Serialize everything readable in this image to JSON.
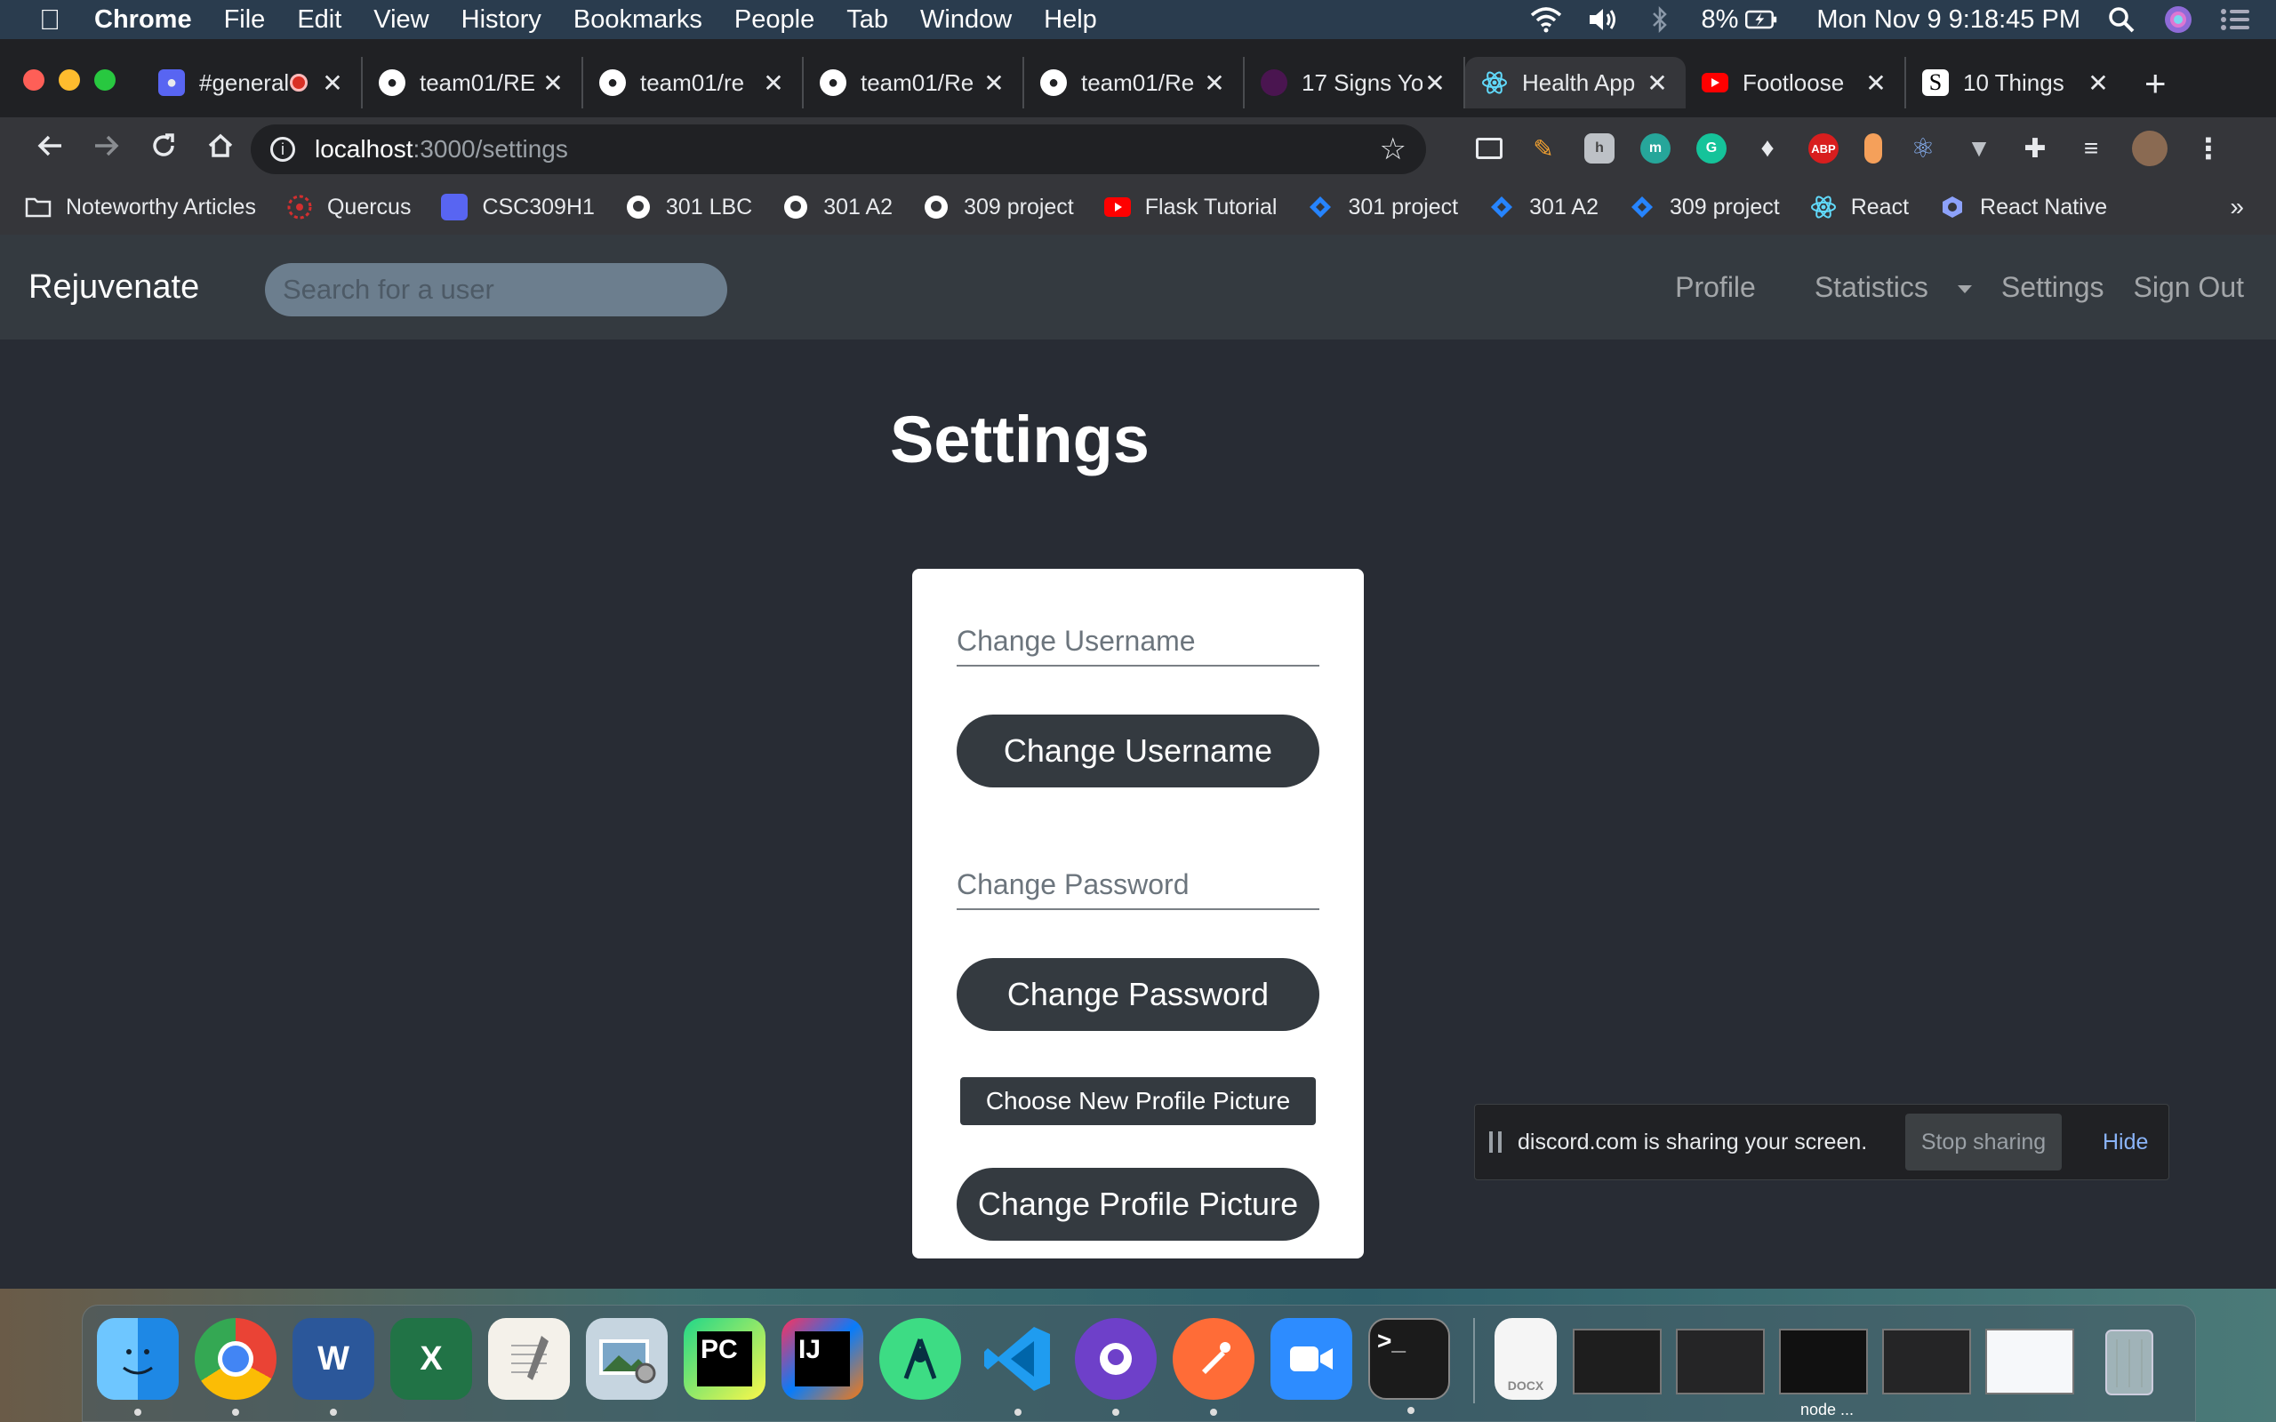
{
  "menubar": {
    "app_name": "Chrome",
    "menus": [
      "File",
      "Edit",
      "View",
      "History",
      "Bookmarks",
      "People",
      "Tab",
      "Window",
      "Help"
    ],
    "battery": "8%",
    "clock": "Mon Nov 9  9:18:45 PM"
  },
  "tabs": [
    {
      "title": "#general",
      "icon": "discord-icon",
      "color": "#5865f2"
    },
    {
      "title": "team01/RE",
      "icon": "github-icon",
      "color": "#ffffff"
    },
    {
      "title": "team01/re",
      "icon": "github-icon",
      "color": "#ffffff"
    },
    {
      "title": "team01/Re",
      "icon": "github-icon",
      "color": "#ffffff"
    },
    {
      "title": "team01/Re",
      "icon": "github-icon",
      "color": "#ffffff"
    },
    {
      "title": "17 Signs Yo",
      "icon": "article-icon",
      "color": "#4a1550"
    },
    {
      "title": "Health App",
      "icon": "react-icon",
      "color": "#61dafb"
    },
    {
      "title": "Footloose",
      "icon": "youtube-icon",
      "color": "#ff0000"
    },
    {
      "title": "10 Things",
      "icon": "s-icon",
      "color": "#ffffff"
    }
  ],
  "toolbar": {
    "url_host": "localhost",
    "url_path": ":3000/settings"
  },
  "bookmarks": [
    {
      "label": "Noteworthy Articles",
      "icon": "folder-icon",
      "color": "#e8eaed"
    },
    {
      "label": "Quercus",
      "icon": "quercus-icon",
      "color": "#d32f2f"
    },
    {
      "label": "CSC309H1",
      "icon": "discord-icon",
      "color": "#5865f2"
    },
    {
      "label": "301 LBC",
      "icon": "github-icon",
      "color": "#ffffff"
    },
    {
      "label": "301 A2",
      "icon": "github-icon",
      "color": "#ffffff"
    },
    {
      "label": "309 project",
      "icon": "github-icon",
      "color": "#ffffff"
    },
    {
      "label": "Flask Tutorial",
      "icon": "youtube-icon",
      "color": "#ff0000"
    },
    {
      "label": "301 project",
      "icon": "jira-icon",
      "color": "#2684ff"
    },
    {
      "label": "301 A2",
      "icon": "jira-icon",
      "color": "#2684ff"
    },
    {
      "label": "309 project",
      "icon": "jira-icon",
      "color": "#2684ff"
    },
    {
      "label": "React",
      "icon": "react-icon",
      "color": "#61dafb"
    },
    {
      "label": "React Native",
      "icon": "react-native-icon",
      "color": "#8da2fb"
    }
  ],
  "app": {
    "brand": "Rejuvenate",
    "search_placeholder": "Search for a user",
    "nav": {
      "profile": "Profile",
      "statistics": "Statistics",
      "settings": "Settings",
      "sign_out": "Sign Out"
    },
    "page_title": "Settings",
    "form": {
      "username_placeholder": "Change Username",
      "username_button": "Change Username",
      "password_placeholder": "Change Password",
      "password_button": "Change Password",
      "choose_picture": "Choose New Profile Picture",
      "picture_button": "Change Profile Picture"
    }
  },
  "share_bar": {
    "message": "discord.com is sharing your screen.",
    "stop_label": "Stop sharing",
    "hide_label": "Hide"
  },
  "dock": {
    "node_label": "node ...",
    "docx_label": "DOCX"
  },
  "colors": {
    "navbar": "#343a40",
    "page_bg": "#282c34",
    "button_bg": "#343a40",
    "link_blue": "#8ab4f8"
  }
}
